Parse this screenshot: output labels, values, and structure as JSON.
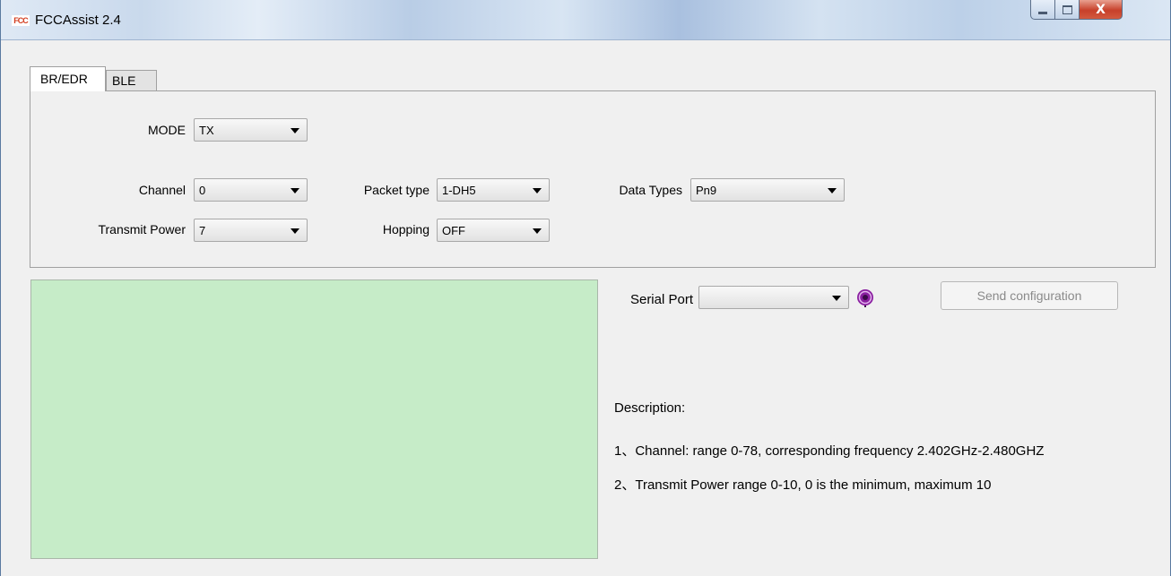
{
  "window": {
    "title": "FCCAssist 2.4",
    "icon_text": "FCC",
    "controls": {
      "minimize": "minimize",
      "maximize": "maximize",
      "close": "X"
    }
  },
  "tabs": [
    {
      "label": "BR/EDR",
      "active": true
    },
    {
      "label": "BLE",
      "active": false
    }
  ],
  "form": {
    "mode": {
      "label": "MODE",
      "value": "TX"
    },
    "channel": {
      "label": "Channel",
      "value": "0"
    },
    "transmit_power": {
      "label": "Transmit Power",
      "value": "7"
    },
    "packet_type": {
      "label": "Packet type",
      "value": "1-DH5"
    },
    "hopping": {
      "label": "Hopping",
      "value": "OFF"
    },
    "data_types": {
      "label": "Data Types",
      "value": "Pn9"
    }
  },
  "serial": {
    "label": "Serial Port",
    "value": "",
    "status_icon": "serial-status-icon",
    "send_label": "Send configuration",
    "send_enabled": false
  },
  "description": {
    "heading": "Description:",
    "lines": [
      "1、Channel: range 0-78, corresponding frequency 2.402GHz-2.480GHZ",
      "2、Transmit Power  range 0-10, 0 is the minimum, maximum 10"
    ]
  },
  "colors": {
    "log_background": "#c6ecc8",
    "status_icon": "#8a1fa0",
    "close_button": "#c7402a"
  }
}
